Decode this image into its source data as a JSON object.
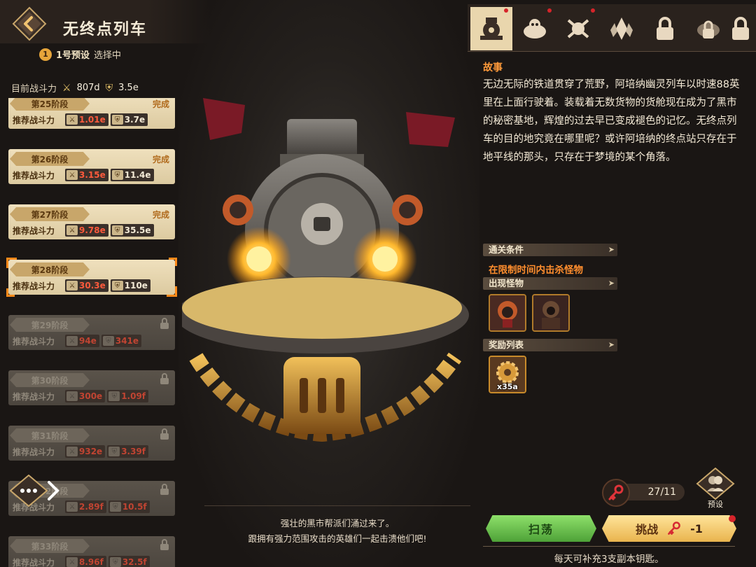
{
  "header": {
    "title": "无终点列车",
    "preset_number": "1",
    "preset_name": "1号预设",
    "preset_state": "选择中"
  },
  "current_power": {
    "label": "目前战斗力",
    "attack": "807d",
    "defense": "3.5e"
  },
  "stages": [
    {
      "name": "第25阶段",
      "rec_label": "推荐战斗力",
      "attack": "1.01e",
      "defense": "3.7e",
      "status": "完成",
      "locked": false,
      "selected": false
    },
    {
      "name": "第26阶段",
      "rec_label": "推荐战斗力",
      "attack": "3.15e",
      "defense": "11.4e",
      "status": "完成",
      "locked": false,
      "selected": false
    },
    {
      "name": "第27阶段",
      "rec_label": "推荐战斗力",
      "attack": "9.78e",
      "defense": "35.5e",
      "status": "完成",
      "locked": false,
      "selected": false
    },
    {
      "name": "第28阶段",
      "rec_label": "推荐战斗力",
      "attack": "30.3e",
      "defense": "110e",
      "status": "",
      "locked": false,
      "selected": true
    },
    {
      "name": "第29阶段",
      "rec_label": "推荐战斗力",
      "attack": "94e",
      "defense": "341e",
      "status": "",
      "locked": true,
      "selected": false
    },
    {
      "name": "第30阶段",
      "rec_label": "推荐战斗力",
      "attack": "300e",
      "defense": "1.09f",
      "status": "",
      "locked": true,
      "selected": false
    },
    {
      "name": "第31阶段",
      "rec_label": "推荐战斗力",
      "attack": "932e",
      "defense": "3.39f",
      "status": "",
      "locked": true,
      "selected": false
    },
    {
      "name": "第32阶段",
      "rec_label": "推荐战斗力",
      "attack": "2.89f",
      "defense": "10.5f",
      "status": "",
      "locked": true,
      "selected": false
    },
    {
      "name": "第33阶段",
      "rec_label": "推荐战斗力",
      "attack": "8.96f",
      "defense": "32.5f",
      "status": "",
      "locked": true,
      "selected": false
    }
  ],
  "dialogue": {
    "line1": "强壮的黑市帮派们涌过来了。",
    "line2": "跟拥有强力范围攻击的英雄们一起击溃他们吧!"
  },
  "tabs": [
    {
      "icon": "train-icon",
      "active": true,
      "dot": true
    },
    {
      "icon": "gang-boss-icon",
      "active": false,
      "dot": true
    },
    {
      "icon": "skull-crossbones-icon",
      "active": false,
      "dot": true
    },
    {
      "icon": "crystal-icon",
      "active": false,
      "dot": false
    },
    {
      "icon": "locked-tab-icon",
      "active": false,
      "dot": false
    },
    {
      "icon": "locked-boss-icon",
      "active": false,
      "dot": false
    },
    {
      "icon": "locked-tab-icon",
      "active": false,
      "dot": false
    }
  ],
  "story": {
    "title": "故事",
    "text": "无边无际的铁道贯穿了荒野，阿培纳幽灵列车以时速88英里在上面行驶着。装载着无数货物的货舱现在成为了黑市的秘密基地，辉煌的过去早已变成褪色的记忆。无终点列车的目的地究竟在哪里呢？或许阿培纳的终点站只存在于地平线的那头，只存在于梦境的某个角落。"
  },
  "clear_condition": {
    "header": "通关条件",
    "text": "在限制时间内击杀怪物"
  },
  "monsters": {
    "header": "出现怪物"
  },
  "rewards": {
    "header": "奖励列表",
    "items": [
      {
        "icon": "gear-icon",
        "qty": "x35a"
      }
    ]
  },
  "keys": {
    "count": "27/11"
  },
  "preset_button": {
    "label": "预设"
  },
  "sweep_button": {
    "label": "扫荡"
  },
  "challenge_button": {
    "label": "挑战",
    "cost": "-1"
  },
  "daily_note": "每天可补充3支副本钥匙。",
  "colors": {
    "accent_orange": "#ff8e2e",
    "sweep_green": "#6cc44e",
    "challenge_gold": "#f5cc6e",
    "value_red": "#ff5a3c"
  }
}
